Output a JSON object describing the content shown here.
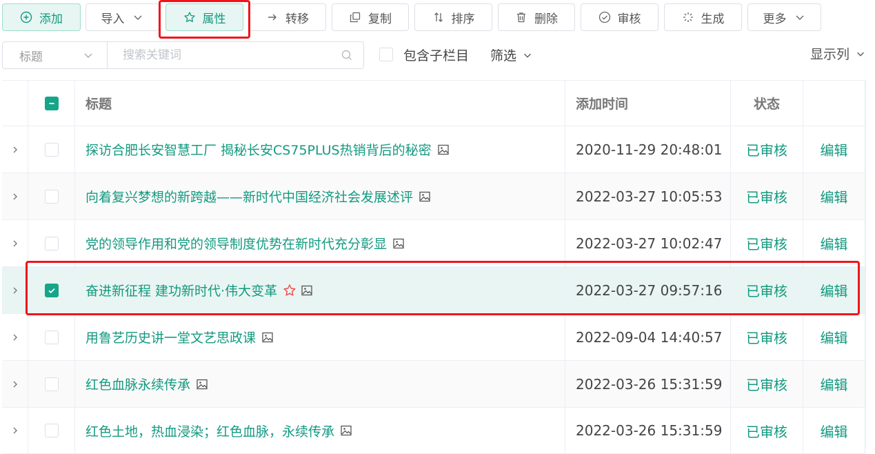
{
  "toolbar": {
    "add": "添加",
    "import": "导入",
    "attributes": "属性",
    "move": "转移",
    "copy": "复制",
    "sort": "排序",
    "delete": "删除",
    "review": "审核",
    "generate": "生成",
    "more": "更多"
  },
  "filter": {
    "field_select": "标题",
    "search_placeholder": "搜索关键词",
    "include_sub": "包含子栏目",
    "filter_label": "筛选",
    "columns_label": "显示列"
  },
  "table": {
    "headers": {
      "title": "标题",
      "time": "添加时间",
      "status": "状态"
    },
    "rows": [
      {
        "title": "探访合肥长安智慧工厂 揭秘长安CS75PLUS热销背后的秘密",
        "time": "2020-11-29 20:48:01",
        "status": "已审核",
        "action": "编辑"
      },
      {
        "title": "向着复兴梦想的新跨越——新时代中国经济社会发展述评",
        "time": "2022-03-27 10:05:53",
        "status": "已审核",
        "action": "编辑"
      },
      {
        "title": "党的领导作用和党的领导制度优势在新时代充分彰显",
        "time": "2022-03-27 10:02:47",
        "status": "已审核",
        "action": "编辑"
      },
      {
        "title": "奋进新征程 建功新时代·伟大变革",
        "time": "2022-03-27 09:57:16",
        "status": "已审核",
        "action": "编辑"
      },
      {
        "title": "用鲁艺历史讲一堂文艺思政课",
        "time": "2022-09-04 14:40:57",
        "status": "已审核",
        "action": "编辑"
      },
      {
        "title": "红色血脉永续传承",
        "time": "2022-03-26 15:31:59",
        "status": "已审核",
        "action": "编辑"
      },
      {
        "title": "红色土地，热血浸染；红色血脉，永续传承",
        "time": "2022-03-26 15:31:59",
        "status": "已审核",
        "action": "编辑"
      }
    ]
  },
  "colors": {
    "accent": "#139a80",
    "highlight": "#f0141b",
    "selected_row": "#e9f5f2"
  }
}
